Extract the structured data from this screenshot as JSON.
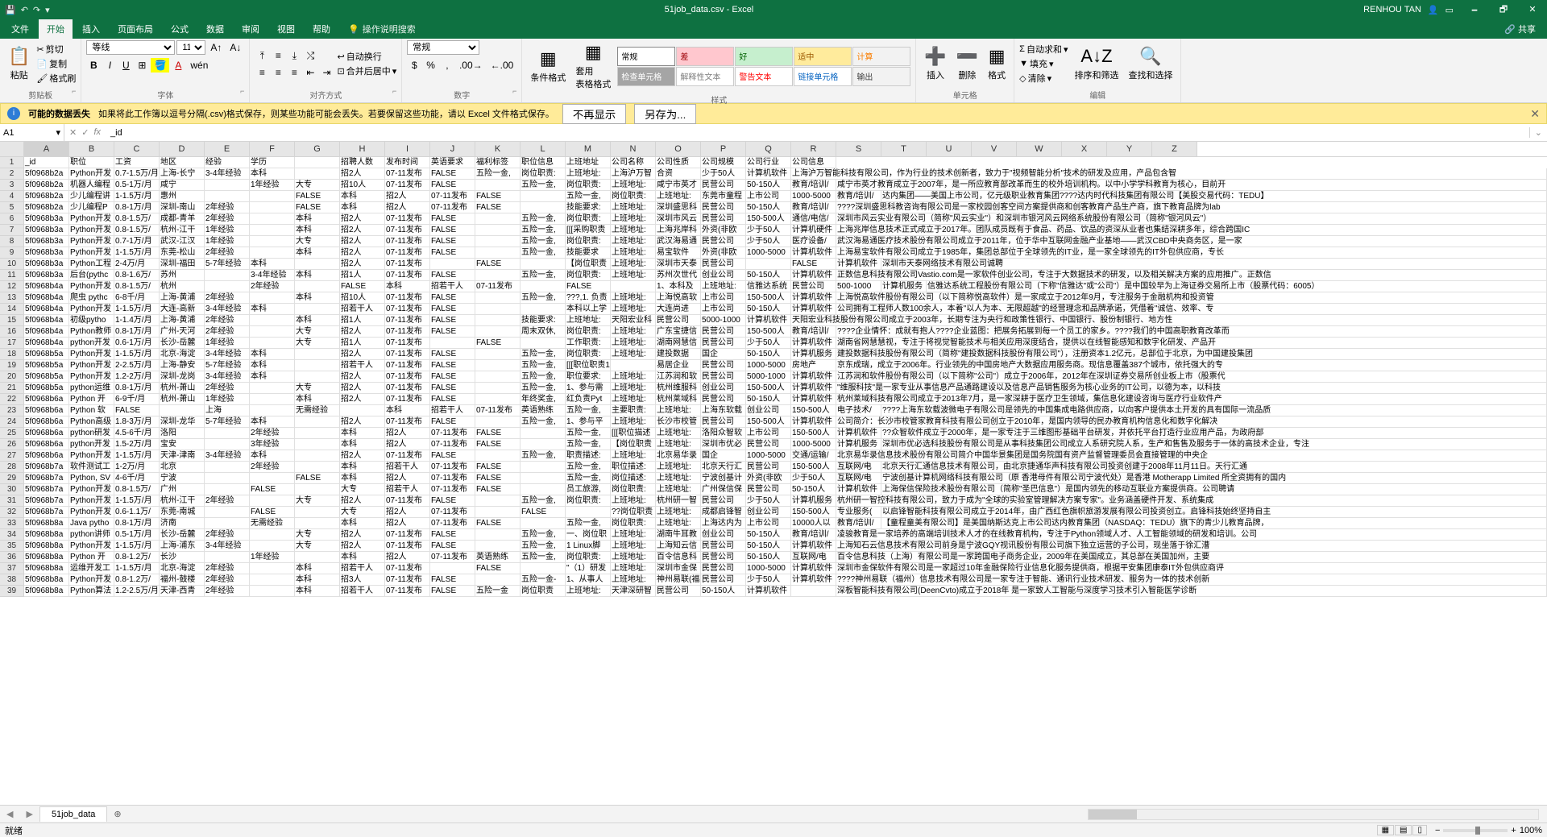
{
  "titlebar": {
    "filename": "51job_data.csv - Excel",
    "username": "RENHOU TAN",
    "qa": [
      "💾",
      "↶",
      "↷",
      "▾"
    ],
    "win": [
      "🗕",
      "🗗",
      "✕"
    ]
  },
  "ribbon_tabs": [
    "文件",
    "开始",
    "插入",
    "页面布局",
    "公式",
    "数据",
    "审阅",
    "视图",
    "帮助"
  ],
  "ribbon_tell": "操作说明搜索",
  "ribbon_share": "共享",
  "ribbon": {
    "clipboard": {
      "paste": "粘贴",
      "cut": "剪切",
      "copy": "复制",
      "format": "格式刷",
      "label": "剪贴板"
    },
    "font": {
      "name": "等线",
      "size": "11",
      "label": "字体"
    },
    "align": {
      "wrap": "自动换行",
      "merge": "合并后居中",
      "label": "对齐方式"
    },
    "number": {
      "format": "常规",
      "label": "数字"
    },
    "styles": {
      "cond": "条件格式",
      "table": "套用\n表格格式",
      "label": "样式",
      "gallery": [
        [
          "常规",
          "差",
          "好",
          "适中",
          "计算"
        ],
        [
          "检查单元格",
          "解释性文本",
          "警告文本",
          "链接单元格",
          "输出"
        ]
      ],
      "gallery_colors": [
        [
          "#fff,#000",
          "#ffc7ce,#9c0006",
          "#c6efce,#006100",
          "#ffeb9c,#9c5700",
          "#f2f2f2,#fa7d00"
        ],
        [
          "#a5a5a5,#fff",
          "#fff,#7f7f7f",
          "#fff,#ff0000",
          "#fff,#0563c1",
          "#f2f2f2,#3f3f3f"
        ]
      ]
    },
    "cells": {
      "insert": "插入",
      "delete": "删除",
      "format": "格式",
      "label": "单元格"
    },
    "editing": {
      "sum": "自动求和",
      "fill": "填充",
      "clear": "清除",
      "sort": "排序和筛选",
      "find": "查找和选择",
      "label": "编辑"
    }
  },
  "warnbar": {
    "title": "可能的数据丢失",
    "text": "如果将此工作簿以逗号分隔(.csv)格式保存，则某些功能可能会丢失。若要保留这些功能，请以 Excel 文件格式保存。",
    "btn1": "不再显示",
    "btn2": "另存为..."
  },
  "fx": {
    "namebox": "A1",
    "formula": "_id"
  },
  "columns": [
    "A",
    "B",
    "C",
    "D",
    "E",
    "F",
    "G",
    "H",
    "I",
    "J",
    "K",
    "L",
    "M",
    "N",
    "O",
    "P",
    "Q",
    "R",
    "S",
    "T",
    "U",
    "V",
    "W",
    "X",
    "Y",
    "Z"
  ],
  "headers": [
    "_id",
    "职位",
    "工资",
    "地区",
    "经验",
    "学历",
    "",
    "招聘人数",
    "发布时间",
    "英语要求",
    "福利标签",
    "职位信息",
    "上班地址",
    "公司名称",
    "公司性质",
    "公司规模",
    "公司行业",
    "公司信息"
  ],
  "rows": [
    [
      "5f0968b2a",
      "Python开发",
      "0.7-1.5万/月",
      "上海-长宁",
      "3-4年经验",
      "本科",
      "",
      "招2人",
      "07-11发布",
      "FALSE",
      "五险一金,",
      "岗位职责:",
      "上班地址:",
      "上海沪万智",
      "合资",
      "少于50人",
      "计算机软件",
      "上海沪万智能科技有限公司，作为行业的技术创新者，致力于\"视频智能分析\"技术的研发及应用，产品包含智"
    ],
    [
      "5f0968b2a",
      "机器人编程",
      "0.5-1万/月",
      "咸宁",
      "",
      "1年经验",
      "大专",
      "招10人",
      "07-11发布",
      "FALSE",
      "",
      "五险一金,",
      "岗位职责:",
      "上班地址:",
      "咸宁市英才",
      "民营公司",
      "50-150人",
      "教育/培训/",
      "咸宁市英才教育成立于2007年，是一所应教育部改革而生的校外培训机构。以中小学学科教育为核心，目前开"
    ],
    [
      "5f0968b2a",
      "少儿编程讲",
      "1-1.5万/月",
      "惠州",
      "",
      "",
      "FALSE",
      "本科",
      "招2人",
      "07-11发布",
      "FALSE",
      "",
      "五险一金,",
      "岗位职责:",
      "上班地址:",
      "东莞市童程",
      "上市公司",
      "1000-5000",
      "教育/培训/",
      "达内集团——美国上市公司，亿元级职业教育集团????达内时代科技集团有限公司【美股交易代码：TEDU】"
    ],
    [
      "5f0968b2a",
      "少儿编程P",
      "0.8-1万/月",
      "深圳-南山",
      "2年经验",
      "",
      "FALSE",
      "本科",
      "招2人",
      "07-11发布",
      "FALSE",
      "",
      "技能要求:",
      "上班地址:",
      "深圳盛思科",
      "民营公司",
      "50-150人",
      "教育/培训/",
      "????深圳盛思科教咨询有限公司是一家校园创客空间方案提供商和创客教育产品生产商，旗下教育品牌为lab"
    ],
    [
      "5f0968b3a",
      "Python开发",
      "0.8-1.5万/",
      "成都-青羊",
      "2年经验",
      "",
      "本科",
      "招2人",
      "07-11发布",
      "FALSE",
      "",
      "五险一金,",
      "岗位职责:",
      "上班地址:",
      "深圳市风云",
      "民营公司",
      "150-500人",
      "通信/电信/",
      "深圳市风云实业有限公司（简称\"风云实业\"）和深圳市银河风云网络系统股份有限公司（简称\"银河风云\"）"
    ],
    [
      "5f0968b3a",
      "Python开发",
      "0.8-1.5万/",
      "杭州-江干",
      "1年经验",
      "",
      "本科",
      "招2人",
      "07-11发布",
      "FALSE",
      "",
      "五险一金,",
      "[[[采购职责",
      "上班地址:",
      "上海兆岸科",
      "外资(非欧",
      "少于50人",
      "计算机硬件",
      "上海兆岸信息技术正式成立于2017年。团队成员既有于食品、药品、饮品的资深从业者也集结深耕多年，综合跨国IC"
    ],
    [
      "5f0968b3a",
      "Python开发",
      "0.7-1万/月",
      "武汉-江汉",
      "1年经验",
      "",
      "大专",
      "招2人",
      "07-11发布",
      "FALSE",
      "",
      "五险一金,",
      "岗位职责:",
      "上班地址:",
      "武汉海易通",
      "民营公司",
      "少于50人",
      "医疗设备/",
      "武汉海易通医疗技术股份有限公司成立于2011年，位于华中互联网金融产业基地——武汉CBD中央商务区，是一家"
    ],
    [
      "5f0968b3a",
      "Python开发",
      "1-1.5万/月",
      "东莞-松山",
      "2年经验",
      "",
      "本科",
      "招2人",
      "07-11发布",
      "FALSE",
      "",
      "五险一金,",
      "技能要求",
      "上班地址:",
      "易宝软件",
      "外资(非欧",
      "1000-5000",
      "计算机软件",
      "上海易宝软件有限公司成立于1985年，集团总部位于全球领先的IT业，是一家全球领先的IT外包供应商，专长"
    ],
    [
      "5f0968b3a",
      "Python工程",
      "2-4万/月",
      "深圳-福田",
      "5-7年经验",
      "本科",
      "",
      "招2人",
      "07-11发布",
      "",
      "FALSE",
      "",
      "【岗位职责",
      "上班地址:",
      "深圳市天泰",
      "民营公司",
      "",
      "FALSE",
      "计算机软件",
      "深圳市天泰网络技术有限公司诚聘"
    ],
    [
      "5f0968b3a",
      "后台(pythc",
      "0.8-1.6万/",
      "苏州",
      "",
      "3-4年经验",
      "本科",
      "招1人",
      "07-11发布",
      "FALSE",
      "",
      "五险一金,",
      "岗位职责:",
      "上班地址:",
      "苏州次世代",
      "创业公司",
      "50-150人",
      "计算机软件",
      "正数信息科技有限公司Vastio.com是一家软件创业公司，专注于大数据技术的研发，以及相关解决方案的应用推广。正数信"
    ],
    [
      "5f0968b4a",
      "Python开发",
      "0.8-1.5万/",
      "杭州",
      "",
      "2年经验",
      "",
      "FALSE",
      "本科",
      "招若干人",
      "07-11发布",
      "",
      "FALSE",
      "",
      "1、本科及",
      "上班地址:",
      "信雅达系统",
      "民营公司",
      "500-1000",
      "计算机服务",
      "信雅达系统工程股份有限公司（下称\"信雅达\"或\"公司\"）是中国较早为上海证券交易所上市（股票代码：6005）"
    ],
    [
      "5f0968b4a",
      "爬虫 pythc",
      "6-8千/月",
      "上海-黄浦",
      "2年经验",
      "",
      "本科",
      "招10人",
      "07-11发布",
      "FALSE",
      "",
      "五险一金,",
      "???,1. 负责",
      "上班地址:",
      "上海悦高软",
      "上市公司",
      "150-500人",
      "计算机软件",
      "上海悦高软件股份有限公司（以下简称悦高软件）是一家成立于2012年9月，专注服务于金融机构和投资管"
    ],
    [
      "5f0968b4a",
      "Python开发",
      "1-1.5万/月",
      "大连-高新",
      "3-4年经验",
      "本科",
      "",
      "招若干人",
      "07-11发布",
      "FALSE",
      "",
      "",
      "本科以上学",
      "上班地址:",
      "大连尚进",
      "上市公司",
      "50-150人",
      "计算机软件",
      "公司拥有工程师人数100余人，本着\"以人为本、无限超越\"的经营理念和品牌承诺，凭借着\"诚信、效率、专"
    ],
    [
      "5f0968b4a",
      "初级pytho",
      "1-1.4万/月",
      "上海-黄浦",
      "2年经验",
      "",
      "本科",
      "招1人",
      "07-11发布",
      "FALSE",
      "",
      "技能要求:",
      "上班地址:",
      "天阳宏业科",
      "民营公司",
      "5000-1000",
      "计算机软件",
      "天阳宏业科技股份有限公司成立于2003年，长期专注为央行和政策性银行、中国银行、股份制银行、地方性"
    ],
    [
      "5f0968b4a",
      "Python教师",
      "0.8-1万/月",
      "广州-天河",
      "2年经验",
      "",
      "大专",
      "招2人",
      "07-11发布",
      "FALSE",
      "",
      "周末双休,",
      "岗位职责:",
      "上班地址:",
      "广东宝捷信",
      "民营公司",
      "150-500人",
      "教育/培训/",
      "????企业情怀：成就有抱人????企业蓝图：把展务拓展到每一个员工的家乡。????我们的中国高职教育改革而"
    ],
    [
      "5f0968b4a",
      "python开发",
      "0.6-1万/月",
      "长沙-岳麓",
      "1年经验",
      "",
      "大专",
      "招1人",
      "07-11发布",
      "",
      "FALSE",
      "",
      "工作职责:",
      "上班地址:",
      "湖南网慧信",
      "民营公司",
      "少于50人",
      "计算机软件",
      "湖南省网慧慧视，专注于将视觉智能技术与相关应用深度结合，提供以在线智能感知和数字化研发、产品开"
    ],
    [
      "5f0968b5a",
      "Python开发",
      "1-1.5万/月",
      "北京-海淀",
      "3-4年经验",
      "本科",
      "",
      "招2人",
      "07-11发布",
      "FALSE",
      "",
      "五险一金,",
      "岗位职责:",
      "上班地址:",
      "建投数据",
      "国企",
      "50-150人",
      "计算机服务",
      "建投数据科技股份有限公司（简称\"建投数据科技股份有限公司\"），注册资本1.2亿元，总部位于北京，为中国建投集团"
    ],
    [
      "5f0968b5a",
      "Python开发",
      "2-2.5万/月",
      "上海-静安",
      "5-7年经验",
      "本科",
      "",
      "招若干人",
      "07-11发布",
      "FALSE",
      "",
      "五险一金,",
      "[[[职位职责1",
      "",
      "易居企业",
      "民营公司",
      "1000-5000",
      "房地产",
      "京东成瑞，成立于2006年。行业领先的中国房地产大数据应用服务商。现信息覆盖387个城市，依托强大的专"
    ],
    [
      "5f0968b5a",
      "Python开发",
      "1.2-2万/月",
      "深圳-龙岗",
      "3-4年经验",
      "本科",
      "",
      "招2人",
      "07-11发布",
      "FALSE",
      "",
      "五险一金,",
      "职位要求:",
      "上班地址:",
      "江苏润和软",
      "民营公司",
      "5000-1000",
      "计算机软件",
      "江苏润和软件股份有限公司（以下简称\"公司\"）成立于2006年，2012年在深圳证券交易所创业板上市（股票代"
    ],
    [
      "5f0968b5a",
      "python运维",
      "0.8-1万/月",
      "杭州-萧山",
      "2年经验",
      "",
      "大专",
      "招2人",
      "07-11发布",
      "FALSE",
      "",
      "五险一金,",
      "1、参与需",
      "上班地址:",
      "杭州维服科",
      "创业公司",
      "150-500人",
      "计算机软件",
      "\"维服科技\"是一家专业从事信息产品通路建设以及信息产品销售服务为核心业务的IT公司，以德为本，以科技"
    ],
    [
      "5f0968b6a",
      "Python 开",
      "6-9千/月",
      "杭州-萧山",
      "1年经验",
      "",
      "本科",
      "招2人",
      "07-11发布",
      "FALSE",
      "",
      "年终奖金,",
      "红负责Pyt",
      "上班地址:",
      "杭州莱域科",
      "民营公司",
      "50-150人",
      "计算机软件",
      "杭州莱域科技有限公司成立于2013年7月，是一家深耕于医疗卫生领域，集信息化建设咨询与医疗行业软件产"
    ],
    [
      "5f0968b6a",
      "Python 软",
      "FALSE",
      "",
      "上海",
      "",
      "无需经验",
      "",
      "本科",
      "招若干人",
      "07-11发布",
      "英语熟练",
      "五险一金,",
      "主要职责:",
      "上班地址:",
      "上海东软载",
      "创业公司",
      "150-500人",
      "电子技术/",
      "????上海东软载波微电子有限公司是领先的中国集成电路供应商，以向客户提供本土开发的具有国际一流品质"
    ],
    [
      "5f0968b6a",
      "Python高级",
      "1.8-3万/月",
      "深圳-龙华",
      "5-7年经验",
      "本科",
      "",
      "招2人",
      "07-11发布",
      "FALSE",
      "",
      "五险一金,",
      "1、参与平",
      "上班地址:",
      "长沙市校管",
      "民营公司",
      "150-500人",
      "计算机软件",
      "公司简介：长沙市校管家教育科技有限公司创立于2010年，是国内领导的民办教育机构信息化和数字化解决"
    ],
    [
      "5f0968b6a",
      "python研发",
      "4.5-6千/月",
      "洛阳",
      "",
      "2年经验",
      "",
      "本科",
      "招2人",
      "07-11发布",
      "FALSE",
      "",
      "五险一金,",
      "[[[职位描述",
      "上班地址:",
      "洛阳众智软",
      "上市公司",
      "150-500人",
      "计算机软件",
      "??众智软件成立于2000年，是一家专注于三维图形基础平台研发，并依托平台打造行业应用产品，为政府部"
    ],
    [
      "5f0968b6a",
      "python开发",
      "1.5-2万/月",
      "宝安",
      "",
      "3年经验",
      "",
      "本科",
      "招2人",
      "07-11发布",
      "FALSE",
      "",
      "五险一金,",
      "【岗位职责",
      "上班地址:",
      "深圳市优必",
      "民营公司",
      "1000-5000",
      "计算机服务",
      "深圳市优必选科技股份有限公司是从事科技集团公司成立人系研究院人系，生产和售售及服务于一体的高技术企业，专注"
    ],
    [
      "5f0968b6a",
      "Python开发",
      "1-1.5万/月",
      "天津-津南",
      "3-4年经验",
      "本科",
      "",
      "招2人",
      "07-11发布",
      "FALSE",
      "",
      "五险一金,",
      "职责描述:",
      "上班地址:",
      "北京易华录",
      "国企",
      "1000-5000",
      "交通/运输/",
      "北京易华录信息技术股份有限公司简介中国华景集团是国务院国有资产监督管理委员会直接管理的中央企"
    ],
    [
      "5f0968b7a",
      "软件测试工",
      "1-2万/月",
      "北京",
      "",
      "2年经验",
      "",
      "本科",
      "招若干人",
      "07-11发布",
      "FALSE",
      "",
      "五险一金,",
      "职位描述:",
      "上班地址:",
      "北京天行汇",
      "民营公司",
      "150-500人",
      "互联网/电",
      "北京天行汇通信息技术有限公司，由北京捷通华声科技有限公司投资创建于2008年11月11日。天行汇通"
    ],
    [
      "5f0968b7a",
      "Python, SV",
      "4-6千/月",
      "宁波",
      "",
      "",
      "FALSE",
      "本科",
      "招2人",
      "07-11发布",
      "FALSE",
      "",
      "五险一金,",
      "岗位描述:",
      "上班地址:",
      "宁波创基计",
      "外资(非欧",
      "少于50人",
      "互联网/电",
      "宁波创基计算机网络科技有限公司（原 香港母件有限公司宁波代处）是香港 Motherapp Limited 所全资拥有的国内"
    ],
    [
      "5f0968b7a",
      "Python开发",
      "0.8-1.5万/",
      "广州",
      "",
      "FALSE",
      "",
      "大专",
      "招若干人",
      "07-11发布",
      "FALSE",
      "",
      "员工旅游,",
      "岗位职责:",
      "上班地址:",
      "广州保信保",
      "民营公司",
      "50-150人",
      "计算机软件",
      "上海保信保险技术股份有限公司（简称\"圣巴信息\"）是国内领先的移动互联业方案提供商。公司聘请"
    ],
    [
      "5f0968b7a",
      "Python开发",
      "1-1.5万/月",
      "杭州-江干",
      "2年经验",
      "",
      "大专",
      "招2人",
      "07-11发布",
      "FALSE",
      "",
      "五险一金,",
      "岗位职责:",
      "上班地址:",
      "杭州研一智",
      "民营公司",
      "少于50人",
      "计算机服务",
      "杭州研一智控科技有限公司，致力于成为\"全球的实验室管理解决方案专家\"。业务涵盖硬件开发、系统集成"
    ],
    [
      "5f0968b7a",
      "Python开发",
      "0.6-1.1万/",
      "东莞-南城",
      "",
      "FALSE",
      "",
      "大专",
      "招2人",
      "07-11发布",
      "",
      "FALSE",
      "",
      "??岗位职责",
      "上班地址:",
      "成都启锋智",
      "创业公司",
      "150-500人",
      "专业服务(",
      "以启锋智能科技有限公司成立于2014年，由广西红色旗帜旅游发展有限公司投资创立。启锋科技始终坚持自主"
    ],
    [
      "5f0968b8a",
      "Java pytho",
      "0.8-1万/月",
      "济南",
      "",
      "无需经验",
      "",
      "本科",
      "招2人",
      "07-11发布",
      "FALSE",
      "",
      "五险一金,",
      "岗位职责:",
      "上班地址:",
      "上海达内为",
      "上市公司",
      "10000人以",
      "教育/培训/",
      "【童程童美有限公司】是美国纳斯达克上市公司达内教育集团（NASDAQ：TEDU）旗下的青少儿教育品牌，"
    ],
    [
      "5f0968b8a",
      "python讲师",
      "0.5-1万/月",
      "长沙-岳麓",
      "2年经验",
      "",
      "大专",
      "招2人",
      "07-11发布",
      "FALSE",
      "",
      "五险一金,",
      "一、岗位职",
      "上班地址:",
      "湖南牛耳教",
      "创业公司",
      "50-150人",
      "教育/培训/",
      "凌骏教育是一家培养的高端培训技术人才的在线教育机构，专注于Python领域人才、人工智能领域的研发和培训。公司"
    ],
    [
      "5f0968b8a",
      "Python开发",
      "1-1.5万/月",
      "上海-浦东",
      "3-4年经验",
      "",
      "大专",
      "招2人",
      "07-11发布",
      "FALSE",
      "",
      "五险一金,",
      "1 Linux脚",
      "上班地址:",
      "上海知云信",
      "民营公司",
      "50-150人",
      "计算机软件",
      "上海知石云信息技术有限公司前身是宁波GQY视讯股份有限公司旗下独立运营的子公司，现坐落于徐汇漕"
    ],
    [
      "5f0968b8a",
      "Python 开",
      "0.8-1.2万/",
      "长沙",
      "",
      "1年经验",
      "",
      "本科",
      "招2人",
      "07-11发布",
      "英语熟练",
      "五险一金,",
      "岗位职责:",
      "上班地址:",
      "百令信息科",
      "民营公司",
      "50-150人",
      "互联网/电",
      "百令信息科技（上海）有限公司是一家跨国电子商务企业，2009年在美国成立，其总部在美国加州，主要"
    ],
    [
      "5f0968b8a",
      "运维开发工",
      "1-1.5万/月",
      "北京-海淀",
      "2年经验",
      "",
      "本科",
      "招若干人",
      "07-11发布",
      "",
      "FALSE",
      "",
      "\"（1）研发",
      "上班地址:",
      "深圳市金保",
      "民营公司",
      "1000-5000",
      "计算机软件",
      "深圳市金保软件有限公司是一家超过10年金融保险行业信息化服务提供商，根据平安集团康泰IT外包供应商评"
    ],
    [
      "5f0968b8a",
      "Python开发",
      "0.8-1.2万/",
      "福州-鼓楼",
      "2年经验",
      "",
      "本科",
      "招3人",
      "07-11发布",
      "FALSE",
      "",
      "五险一金-",
      "1、从事人",
      "上班地址:",
      "神州易联(福",
      "民营公司",
      "少于50人",
      "计算机软件",
      "????神州易联（福州）信息技术有限公司是一家专注于智能、通讯行业技术研发、服务为一体的技术创新"
    ],
    [
      "5f0968b8a",
      "Python算法",
      "1.2-2.5万/月",
      "天津-西青",
      "2年经验",
      "",
      "本科",
      "招若干人",
      "07-11发布",
      "FALSE",
      "五险一金",
      "岗位职责",
      "上班地址:",
      "天津深研智",
      "民营公司",
      "50-150人",
      "计算机软件",
      "",
      "深板智能科技有限公司(DeenCvto)成立于2018年 是一家致人工智能与深度学习技术引入智能医学诊断"
    ]
  ],
  "sheettab": "51job_data",
  "status": {
    "ready": "就绪",
    "zoom": "100%"
  }
}
